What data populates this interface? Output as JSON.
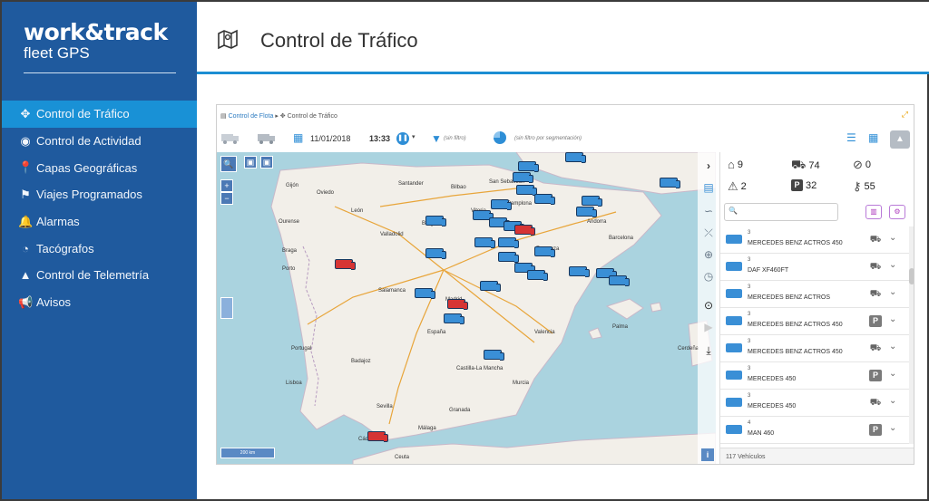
{
  "brand": {
    "main": "work&track",
    "sub": "fleet GPS"
  },
  "sidebar": {
    "items": [
      {
        "label": "Control de Tráfico",
        "icon": "crosshair-icon",
        "active": true
      },
      {
        "label": "Control de Actividad",
        "icon": "target-icon",
        "active": false
      },
      {
        "label": "Capas Geográficas",
        "icon": "pin-icon",
        "active": false
      },
      {
        "label": "Viajes Programados",
        "icon": "flag-icon",
        "active": false
      },
      {
        "label": "Alarmas",
        "icon": "bell-icon",
        "active": false
      },
      {
        "label": "Tacógrafos",
        "icon": "gauge-icon",
        "active": false
      },
      {
        "label": "Control de Telemetría",
        "icon": "chart-icon",
        "active": false
      },
      {
        "label": "Avisos",
        "icon": "megaphone-icon",
        "active": false
      }
    ]
  },
  "header": {
    "title": "Control de Tráfico",
    "icon": "map-icon"
  },
  "breadcrumb": {
    "root": "Control de Flota",
    "separator": "▸",
    "current": "Control de Tráfico"
  },
  "toolbar": {
    "date": "11/01/2018",
    "time": "13:33",
    "filter_text": "(sin filtro)",
    "segment_text": "(sin filtro por segmentación)"
  },
  "stats": {
    "moving": "9",
    "stopped": "74",
    "no_signal": "0",
    "alerts": "2",
    "parked": "32",
    "ignition": "55"
  },
  "search": {
    "placeholder": ""
  },
  "vehicles": [
    {
      "plate": "3",
      "model": "MERCEDES BENZ ACTROS 450",
      "state": "stopped"
    },
    {
      "plate": "3",
      "model": "DAF XF460FT",
      "state": "stopped"
    },
    {
      "plate": "3",
      "model": "MERCEDES BENZ ACTROS",
      "state": "stopped"
    },
    {
      "plate": "3",
      "model": "MERCEDES BENZ ACTROS 450",
      "state": "parked"
    },
    {
      "plate": "3",
      "model": "MERCEDES BENZ ACTROS 450",
      "state": "stopped"
    },
    {
      "plate": "3",
      "model": "MERCEDES 450",
      "state": "parked"
    },
    {
      "plate": "3",
      "model": "MERCEDES 450",
      "state": "stopped"
    },
    {
      "plate": "4",
      "model": "MAN 460",
      "state": "parked"
    }
  ],
  "footer": {
    "count": "117 Vehículos"
  },
  "map": {
    "cities": [
      "Gijón",
      "Oviedo",
      "Santander",
      "Bilbao",
      "San Sebastián",
      "Pamplona",
      "Ourense",
      "León",
      "Burgos",
      "Vitoria",
      "Zaragoza",
      "Barcelona",
      "Valladolid",
      "Braga",
      "Porto",
      "Salamanca",
      "Madrid",
      "Valencia",
      "Portugal",
      "España",
      "Badajoz",
      "Castilla-La Mancha",
      "Sevilla",
      "Málaga",
      "Granada",
      "Murcia",
      "Andorra",
      "Palma",
      "Cerdeña",
      "Lisboa",
      "Cádiz",
      "Ceuta"
    ],
    "scale": "200 km",
    "colors": {
      "sea": "#aad3df",
      "land": "#f2efe9",
      "moving": "#3a8fd6",
      "stopped_alert": "#d63434"
    }
  }
}
